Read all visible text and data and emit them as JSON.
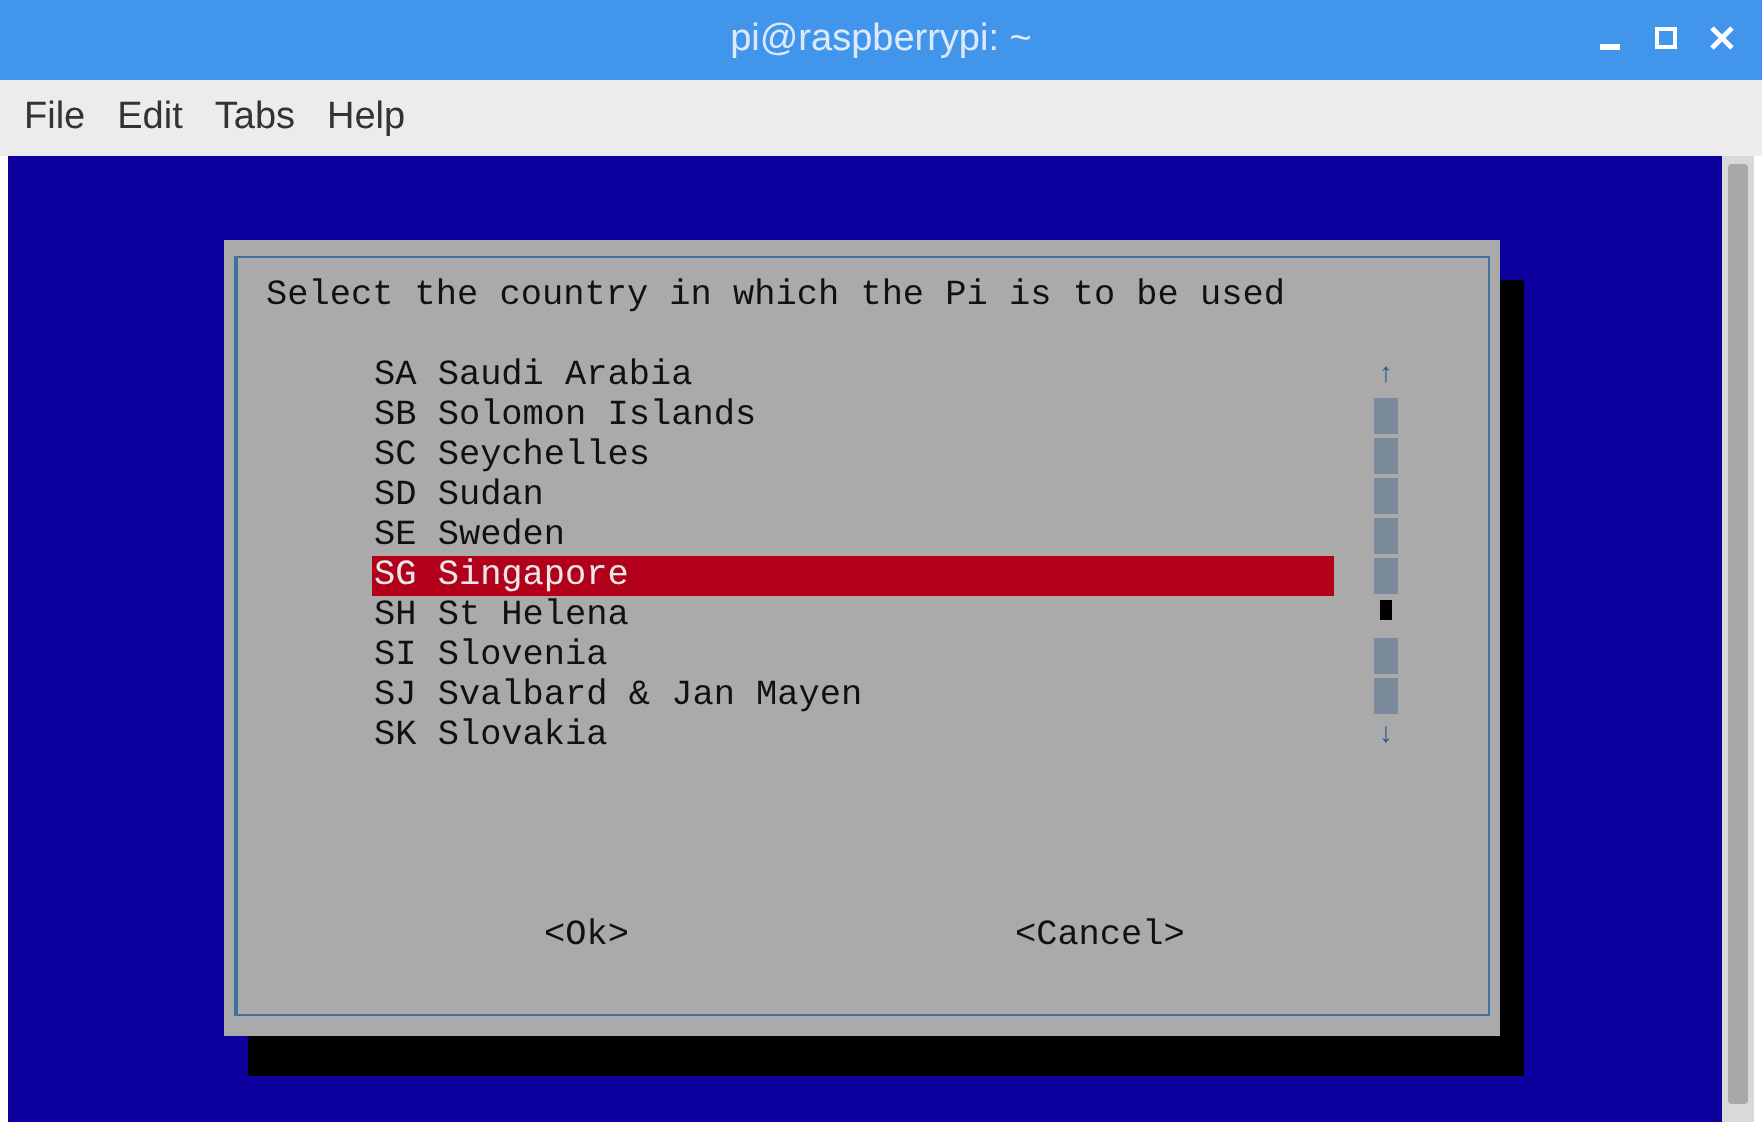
{
  "window": {
    "title": "pi@raspberrypi: ~"
  },
  "menu": [
    "File",
    "Edit",
    "Tabs",
    "Help"
  ],
  "dialog": {
    "prompt": "Select the country in which the Pi is to be used",
    "items": [
      {
        "label": "SA Saudi Arabia",
        "selected": false
      },
      {
        "label": "SB Solomon Islands",
        "selected": false
      },
      {
        "label": "SC Seychelles",
        "selected": false
      },
      {
        "label": "SD Sudan",
        "selected": false
      },
      {
        "label": "SE Sweden",
        "selected": false
      },
      {
        "label": "SG Singapore",
        "selected": true
      },
      {
        "label": "SH St Helena",
        "selected": false
      },
      {
        "label": "SI Slovenia",
        "selected": false
      },
      {
        "label": "SJ Svalbard & Jan Mayen",
        "selected": false
      },
      {
        "label": "SK Slovakia",
        "selected": false
      }
    ],
    "scroll_up": "↑",
    "scroll_down": "↓",
    "buttons": [
      "<Ok>",
      "<Cancel>"
    ]
  }
}
